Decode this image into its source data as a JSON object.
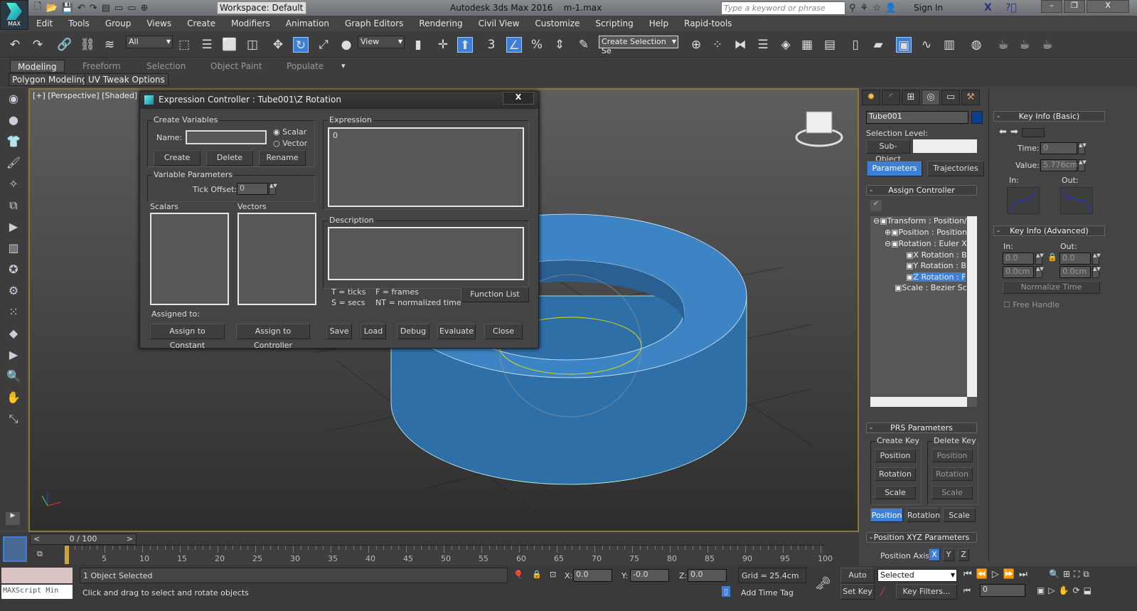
{
  "app": {
    "logo_label": "MAX",
    "title": "Autodesk 3ds Max 2016",
    "file": "m-1.max",
    "workspace": "Workspace: Default",
    "search_placeholder": "Type a keyword or phrase",
    "sign_in": "Sign In"
  },
  "menu": [
    "Edit",
    "Tools",
    "Group",
    "Views",
    "Create",
    "Modifiers",
    "Animation",
    "Graph Editors",
    "Rendering",
    "Civil View",
    "Customize",
    "Scripting",
    "Help",
    "Rapid-tools"
  ],
  "toolbar": {
    "filter": "All",
    "ref_coord": "View",
    "snap_label": "3",
    "selection_set": "Create Selection Se"
  },
  "ribbon": {
    "tabs": [
      "Modeling",
      "Freeform",
      "Selection",
      "Object Paint",
      "Populate"
    ],
    "subtabs": [
      "Polygon Modeling",
      "UV Tweak Options"
    ]
  },
  "viewport": {
    "label": "[+] [Perspective] [Shaded]"
  },
  "dialog": {
    "title": "Expression Controller : Tube001\\Z Rotation",
    "close": "X",
    "create_variables": "Create Variables",
    "name_label": "Name:",
    "name_value": "",
    "scalar": "Scalar",
    "vector": "Vector",
    "create": "Create",
    "delete": "Delete",
    "rename": "Rename",
    "variable_parameters": "Variable Parameters",
    "tick_offset_label": "Tick Offset:",
    "tick_offset": "0",
    "scalars": "Scalars",
    "vectors": "Vectors",
    "expression_label": "Expression",
    "expression": "0",
    "description_label": "Description",
    "legend": [
      "T = ticks",
      "F = frames",
      "S = secs",
      "NT = normalized time"
    ],
    "function_list": "Function List",
    "assigned_to": "Assigned to:",
    "assign_constant": "Assign to Constant",
    "assign_controller": "Assign to Controller",
    "save": "Save",
    "load": "Load",
    "debug": "Debug",
    "evaluate": "Evaluate",
    "close_btn": "Close"
  },
  "command_panel": {
    "object_name": "Tube001",
    "object_color": "#0a3f8f",
    "selection_level": "Selection Level:",
    "sub_object": "Sub-Object",
    "tab_parameters": "Parameters",
    "tab_trajectories": "Trajectories",
    "assign_controller": "Assign Controller",
    "tree": [
      "Transform : Position/",
      "Position : Position",
      "Rotation : Euler X",
      "X Rotation : B",
      "Y Rotation : B",
      "Z Rotation : F",
      "Scale : Bezier Sca"
    ],
    "prs": "PRS Parameters",
    "create_key": "Create Key",
    "delete_key": "Delete Key",
    "position": "Position",
    "rotation": "Rotation",
    "scale": "Scale",
    "pos_xyz": "Position XYZ Parameters",
    "position_axis": "Position Axis:",
    "axes": [
      "X",
      "Y",
      "Z"
    ]
  },
  "key_info": {
    "basic": "Key Info (Basic)",
    "time_label": "Time:",
    "time": "0",
    "value_label": "Value:",
    "value": "5.776cm",
    "in": "In:",
    "out": "Out:",
    "advanced": "Key Info (Advanced)",
    "in_val": "0.0",
    "out_val": "0.0",
    "in_cm": "0.0cm",
    "out_cm": "0.0cm",
    "normalize": "Normalize Time",
    "free_handle": "Free Handle"
  },
  "timeline": {
    "frame": "0 / 100",
    "ticks": [
      "0",
      "5",
      "10",
      "15",
      "20",
      "25",
      "30",
      "35",
      "40",
      "45",
      "50",
      "55",
      "60",
      "65",
      "70",
      "75",
      "80",
      "85",
      "90",
      "95",
      "100"
    ]
  },
  "status": {
    "selected": "1 Object Selected",
    "prompt": "Click and drag to select and rotate objects",
    "maxscript": "MAXScript Min",
    "x_label": "X:",
    "x": "0.0",
    "y_label": "Y:",
    "y": "-0.0",
    "z_label": "Z:",
    "z": "0.0",
    "grid": "Grid = 25.4cm",
    "add_time_tag": "Add Time Tag",
    "auto_key": "Auto Key",
    "set_key": "Set Key",
    "key_mode": "Selected",
    "key_filters": "Key Filters...",
    "current_frame": "0"
  }
}
